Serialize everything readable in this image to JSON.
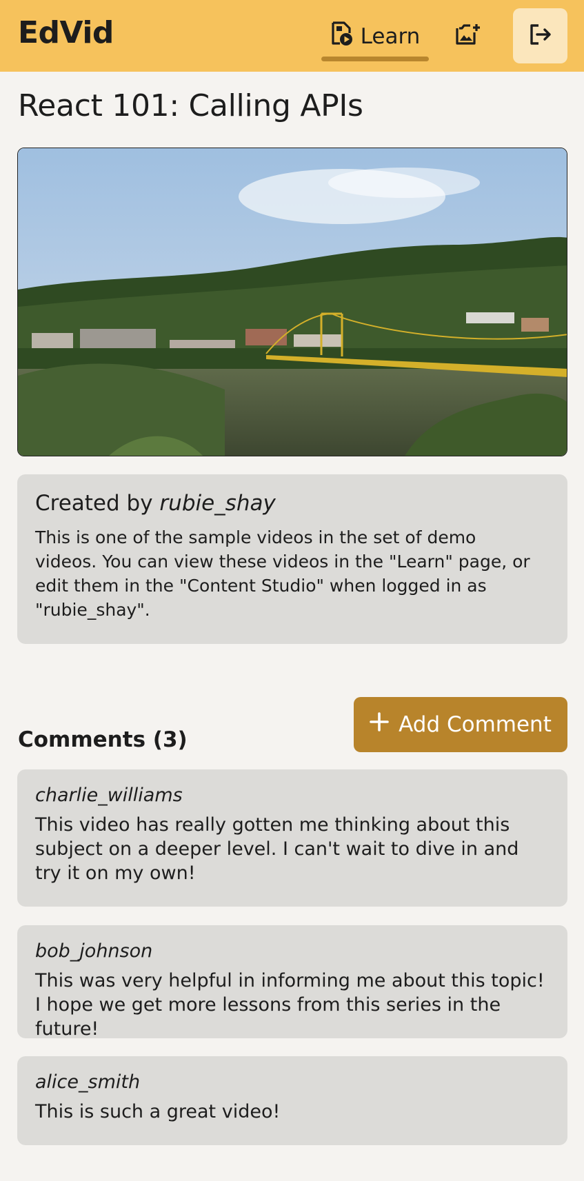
{
  "app": {
    "brand": "EdVid"
  },
  "nav": {
    "learn_label": "Learn",
    "learn_icon": "video-file-icon",
    "studio_icon": "video-camera-icon",
    "logout_icon": "logout-icon"
  },
  "video": {
    "title": "React 101: Calling APIs"
  },
  "info": {
    "created_by_prefix": "Created by",
    "creator": "rubie_shay",
    "description": "This is one of the sample videos in the set of demo videos. You can view these videos in the \"Learn\" page, or edit them in the \"Content Studio\" when logged in as \"rubie_shay\"."
  },
  "comments": {
    "heading": "Comments (3)",
    "add_label": "Add Comment",
    "items": [
      {
        "author": "charlie_williams",
        "text": "This video has really gotten me thinking about this subject on a deeper level. I can't wait to dive in and try it on my own!"
      },
      {
        "author": "bob_johnson",
        "text": "This was very helpful in informing me about this topic! I hope we get more lessons from this series in the future!"
      },
      {
        "author": "alice_smith",
        "text": "This is such a great video!"
      }
    ]
  },
  "colors": {
    "header": "#f6c25c",
    "accent": "#b8842b",
    "card": "#dcdbd8",
    "background": "#f5f3f0"
  }
}
